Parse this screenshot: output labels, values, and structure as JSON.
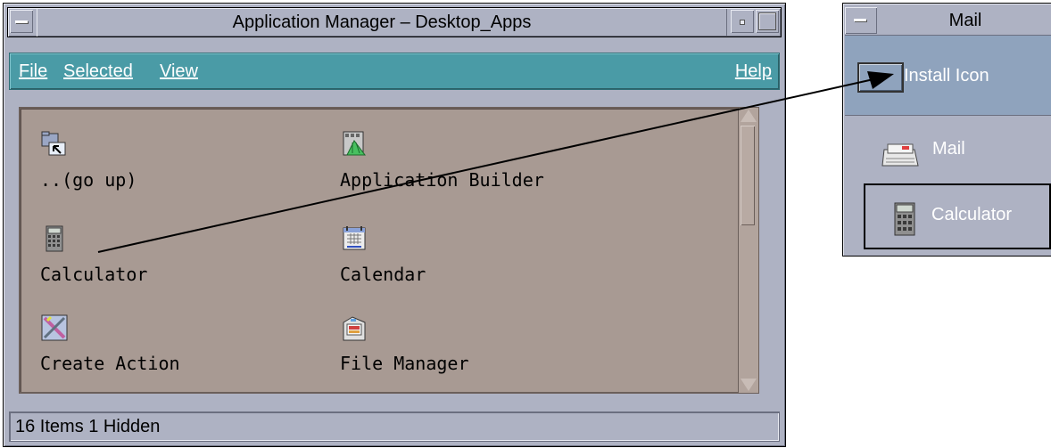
{
  "window": {
    "title": "Application Manager – Desktop_Apps"
  },
  "menubar": {
    "file_label": "File",
    "selected_label": "Selected",
    "view_label": "View",
    "help_label": "Help"
  },
  "items": [
    {
      "label": "..(go up)",
      "icon": "folder-up-icon"
    },
    {
      "label": "Application Builder",
      "icon": "app-builder-icon"
    },
    {
      "label": "Calculator",
      "icon": "calculator-icon"
    },
    {
      "label": "Calendar",
      "icon": "calendar-icon"
    },
    {
      "label": "Create Action",
      "icon": "create-action-icon"
    },
    {
      "label": "File Manager",
      "icon": "file-manager-icon"
    }
  ],
  "status": {
    "text": "16 Items 1 Hidden"
  },
  "mail_panel": {
    "title": "Mail",
    "install_icon_label": "Install Icon",
    "entries": [
      {
        "label": "Mail",
        "icon": "mail-icon"
      },
      {
        "label": "Calculator",
        "icon": "calculator-icon"
      }
    ]
  },
  "colors": {
    "window_frame": "#aeb2c3",
    "menubar": "#4a9ba6",
    "viewport": "#a89a93",
    "subpanel_install": "#8fa3bd"
  }
}
